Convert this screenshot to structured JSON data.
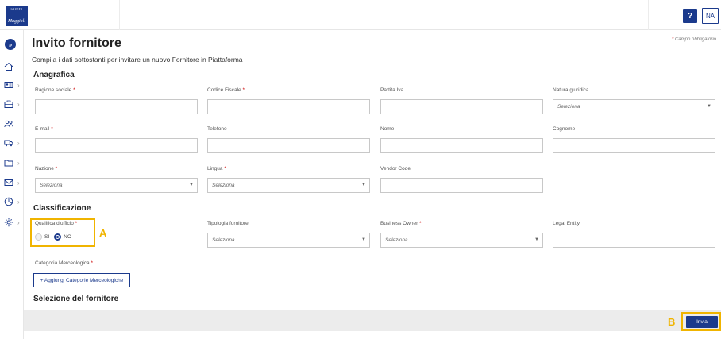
{
  "header": {
    "logo_top": "GRUPPO",
    "logo_name": "Maggioli",
    "help_label": "?",
    "avatar_initials": "NA"
  },
  "sidebar": {
    "items": [
      {
        "icon": "home-icon",
        "has_chevron": false
      },
      {
        "icon": "id-card-icon",
        "has_chevron": true
      },
      {
        "icon": "briefcase-icon",
        "has_chevron": true
      },
      {
        "icon": "users-icon",
        "has_chevron": false
      },
      {
        "icon": "truck-icon",
        "has_chevron": true
      },
      {
        "icon": "folder-icon",
        "has_chevron": true
      },
      {
        "icon": "mail-icon",
        "has_chevron": true
      },
      {
        "icon": "chart-icon",
        "has_chevron": true
      },
      {
        "icon": "gear-icon",
        "has_chevron": true
      }
    ]
  },
  "page": {
    "title": "Invito fornitore",
    "required_note": "Campo obbligatorio",
    "subtitle": "Compila i dati sottostanti per invitare un nuovo Fornitore in Piattaforma"
  },
  "sections": {
    "anagrafica": "Anagrafica",
    "classificazione": "Classificazione",
    "selezione": "Selezione del fornitore"
  },
  "fields": {
    "ragione_sociale": {
      "label": "Ragione sociale",
      "value": ""
    },
    "codice_fiscale": {
      "label": "Codice Fiscale",
      "value": ""
    },
    "partita_iva": {
      "label": "Partita Iva",
      "value": ""
    },
    "natura_giuridica": {
      "label": "Natura giuridica",
      "value": "Seleziona"
    },
    "email": {
      "label": "E-mail",
      "value": ""
    },
    "telefono": {
      "label": "Telefono",
      "value": ""
    },
    "nome": {
      "label": "Nome",
      "value": ""
    },
    "cognome": {
      "label": "Cognome",
      "value": ""
    },
    "nazione": {
      "label": "Nazione",
      "value": "Seleziona"
    },
    "lingua": {
      "label": "Lingua",
      "value": "Seleziona"
    },
    "vendor_code": {
      "label": "Vendor Code",
      "value": ""
    },
    "qualifica": {
      "label": "Qualifica d'ufficio",
      "option_si": "SI",
      "option_no": "NO",
      "selected": "NO"
    },
    "tipologia": {
      "label": "Tipologia fornitore",
      "value": "Seleziona"
    },
    "business_owner": {
      "label": "Business Owner",
      "value": "Seleziona"
    },
    "legal_entity": {
      "label": "Legal Entity",
      "value": ""
    },
    "categoria": {
      "label": "Categoria Merceologica"
    }
  },
  "buttons": {
    "add_categories": "+ Aggiungi Categorie Merceologiche",
    "submit": "Invia"
  },
  "annotations": {
    "marker_a": "A",
    "marker_b": "B"
  },
  "colors": {
    "brand": "#1b3a8c",
    "required": "#cc0000",
    "highlight": "#f0b400"
  }
}
